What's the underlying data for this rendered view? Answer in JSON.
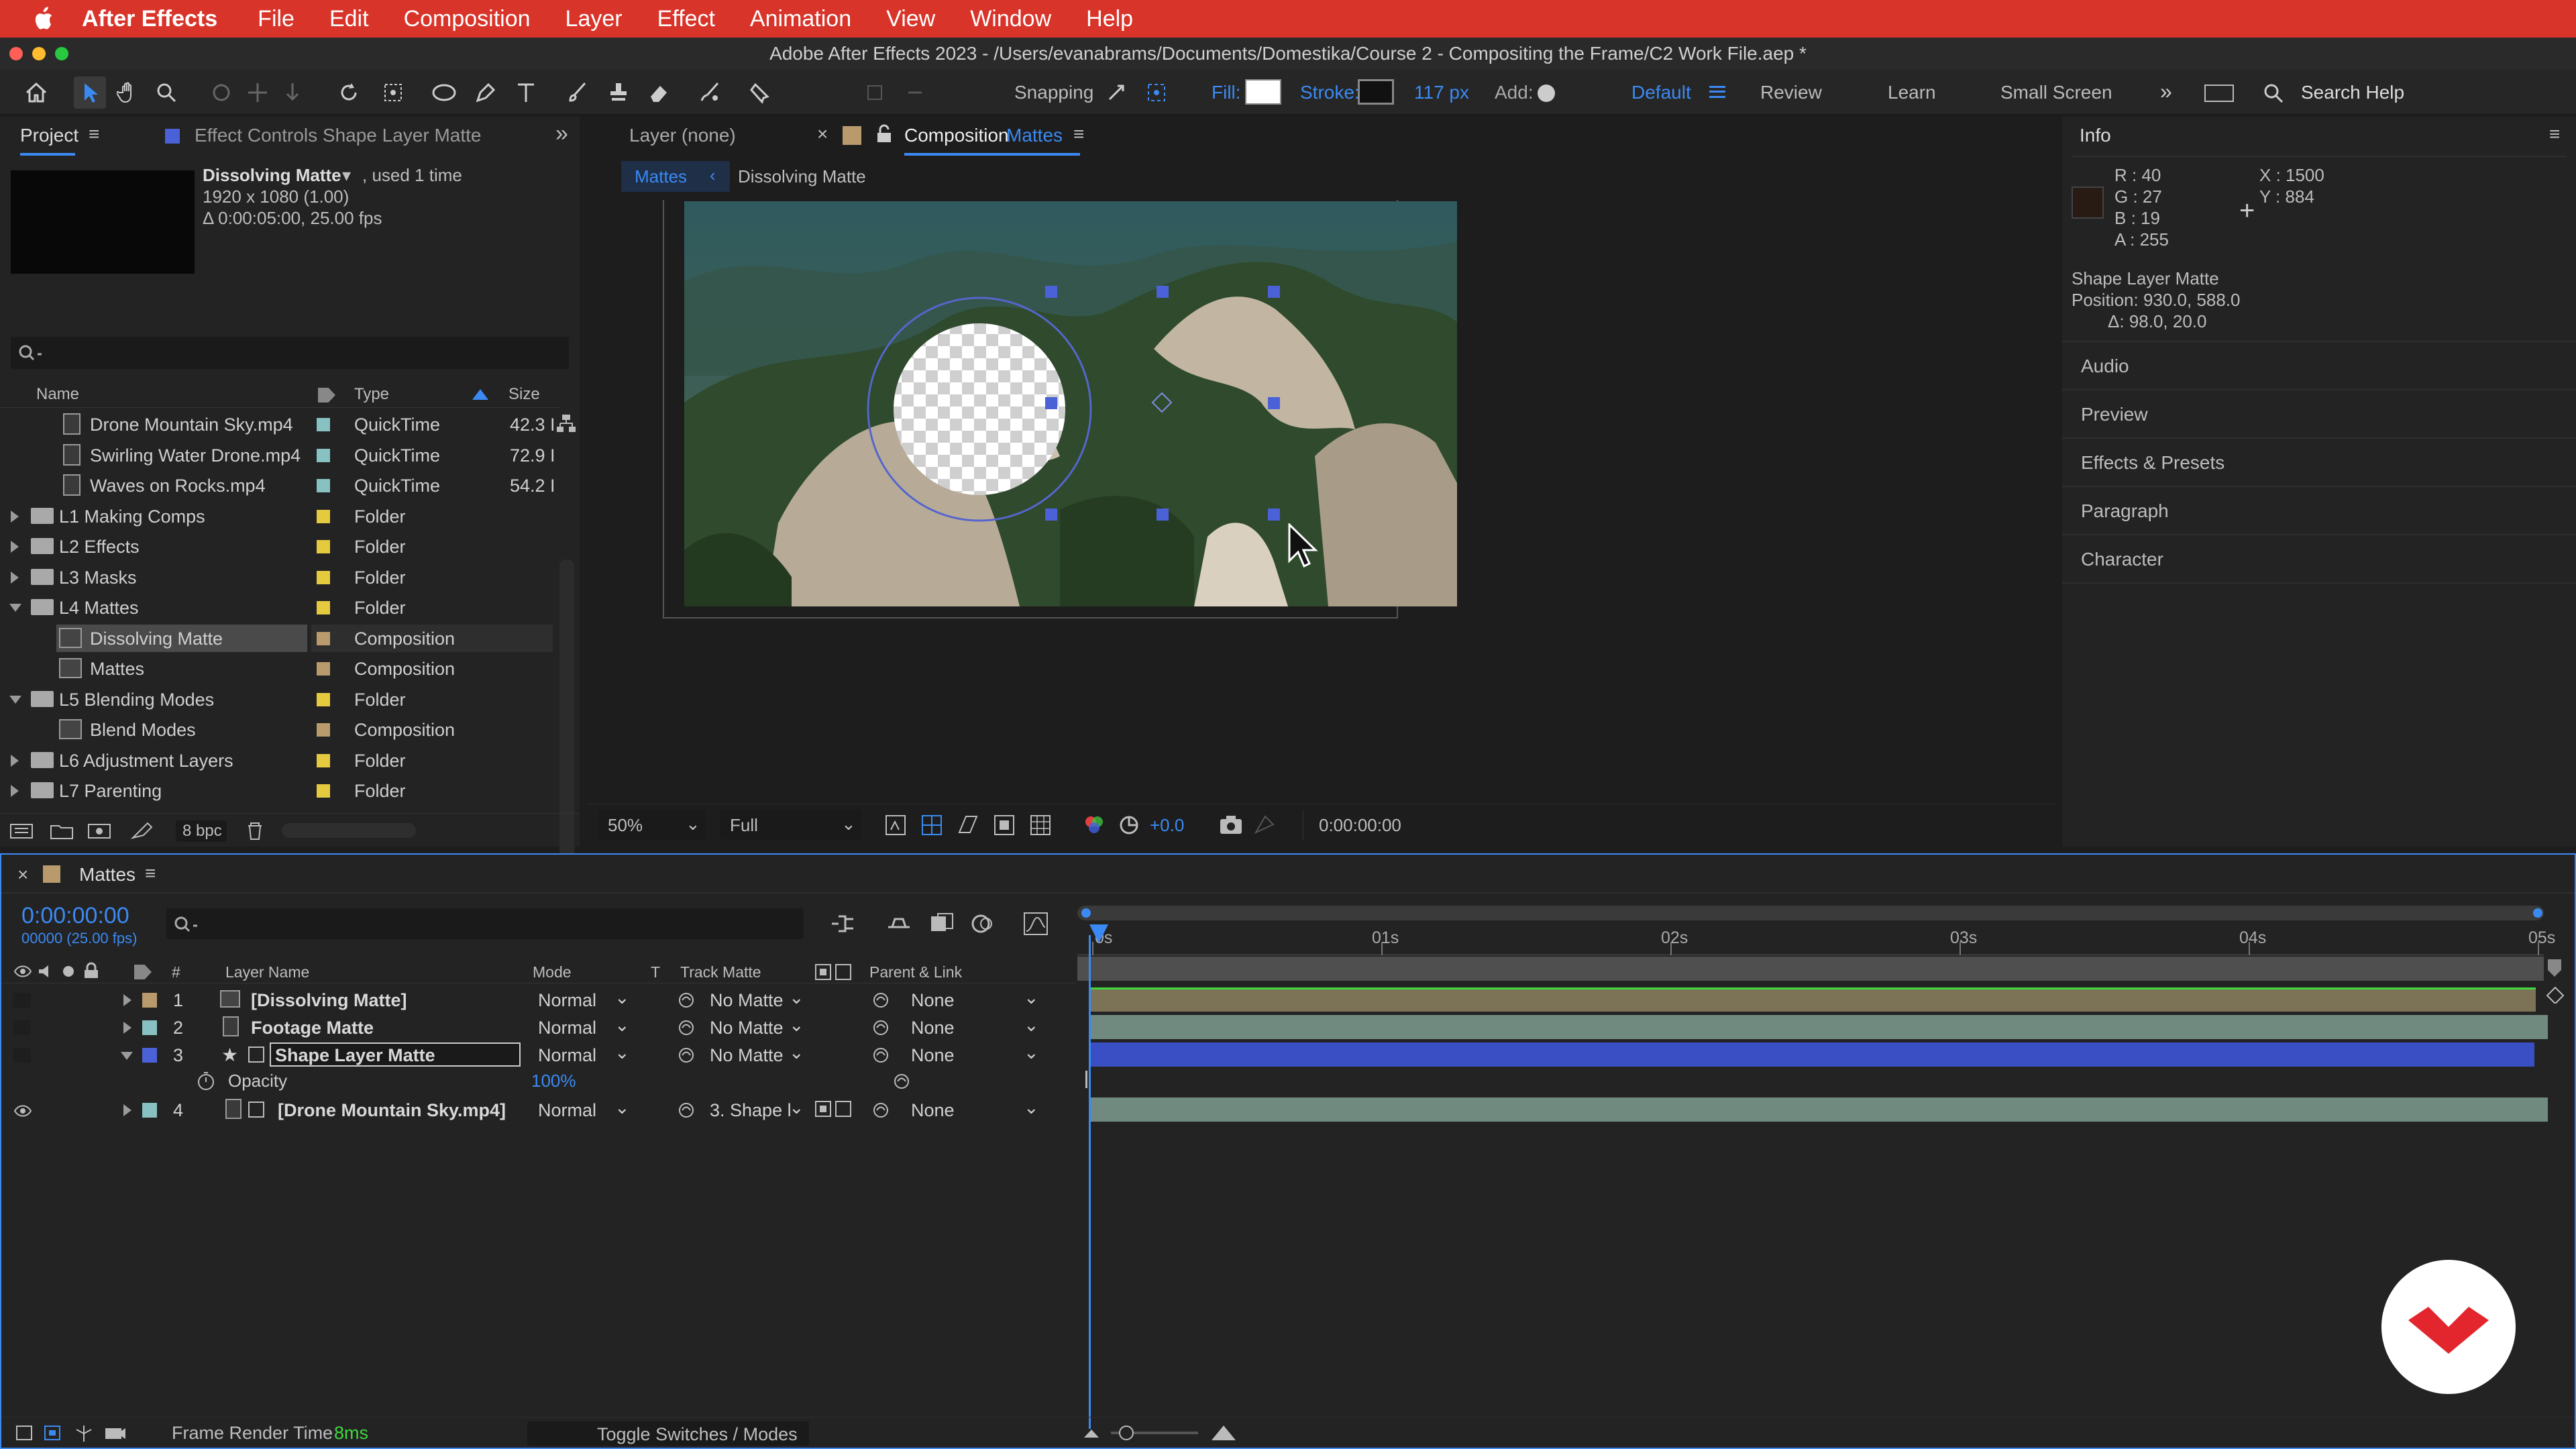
{
  "menubar": {
    "app": "After Effects",
    "items": [
      "File",
      "Edit",
      "Composition",
      "Layer",
      "Effect",
      "Animation",
      "View",
      "Window",
      "Help"
    ]
  },
  "window": {
    "title": "Adobe After Effects 2023 - /Users/evanabrams/Documents/Domestika/Course 2 - Compositing the Frame/C2 Work File.aep *"
  },
  "toolbar": {
    "snapping": "Snapping",
    "fill": "Fill:",
    "stroke": "Stroke:",
    "stroke_px": "117 px",
    "add": "Add:",
    "workspaces": [
      "Default",
      "Review",
      "Learn",
      "Small Screen"
    ],
    "search": "Search Help"
  },
  "project": {
    "tab": "Project",
    "effect_tab": "Effect Controls Shape Layer Matte",
    "selected_name": "Dissolving Matte",
    "used": ", used 1 time",
    "dims": "1920 x 1080 (1.00)",
    "duration": "Δ 0:00:05:00, 25.00 fps",
    "columns": {
      "name": "Name",
      "type": "Type",
      "size": "Size"
    },
    "items": [
      {
        "name": "Drone Mountain Sky.mp4",
        "type": "QuickTime",
        "size": "42.3 I",
        "kind": "file",
        "color": "#87c1c1"
      },
      {
        "name": "Swirling Water Drone.mp4",
        "type": "QuickTime",
        "size": "72.9 I",
        "kind": "file",
        "color": "#87c1c1"
      },
      {
        "name": "Waves on Rocks.mp4",
        "type": "QuickTime",
        "size": "54.2 I",
        "kind": "file",
        "color": "#87c1c1"
      },
      {
        "name": "L1 Making Comps",
        "type": "Folder",
        "size": "",
        "kind": "folder",
        "color": "#e5c93e"
      },
      {
        "name": "L2 Effects",
        "type": "Folder",
        "size": "",
        "kind": "folder",
        "color": "#e5c93e"
      },
      {
        "name": "L3 Masks",
        "type": "Folder",
        "size": "",
        "kind": "folder",
        "color": "#e5c93e"
      },
      {
        "name": "L4 Mattes",
        "type": "Folder",
        "size": "",
        "kind": "folder-open",
        "color": "#e5c93e"
      },
      {
        "name": "Dissolving Matte",
        "type": "Composition",
        "size": "",
        "kind": "comp",
        "color": "#b89a6c"
      },
      {
        "name": "Mattes",
        "type": "Composition",
        "size": "",
        "kind": "comp",
        "color": "#b89a6c"
      },
      {
        "name": "L5 Blending Modes",
        "type": "Folder",
        "size": "",
        "kind": "folder-open",
        "color": "#e5c93e"
      },
      {
        "name": "Blend Modes",
        "type": "Composition",
        "size": "",
        "kind": "comp",
        "color": "#b89a6c"
      },
      {
        "name": "L6 Adjustment Layers",
        "type": "Folder",
        "size": "",
        "kind": "folder",
        "color": "#e5c93e"
      },
      {
        "name": "L7 Parenting",
        "type": "Folder",
        "size": "",
        "kind": "folder",
        "color": "#e5c93e"
      }
    ],
    "bpc": "8 bpc"
  },
  "viewer": {
    "layer_tab": "Layer (none)",
    "comp_tab_prefix": "Composition",
    "comp_tab_name": "Mattes",
    "crumb1": "Mattes",
    "crumb2": "Dissolving Matte",
    "zoom": "50%",
    "quality": "Full",
    "exposure": "+0.0",
    "timecode": "0:00:00:00"
  },
  "info": {
    "title": "Info",
    "r": "R : 40",
    "g": "G : 27",
    "b": "B : 19",
    "a": "A : 255",
    "x": "X : 1500",
    "y": "Y : 884",
    "layer": "Shape Layer Matte",
    "position": "Position: 930.0, 588.0",
    "delta": "Δ: 98.0, 20.0",
    "swatch": "#281b13",
    "sections": [
      "Audio",
      "Preview",
      "Effects & Presets",
      "Paragraph",
      "Character"
    ]
  },
  "timeline": {
    "tab": "Mattes",
    "timecode": "0:00:00:00",
    "frames": "00000 (25.00 fps)",
    "headers": {
      "num": "#",
      "layer_name": "Layer Name",
      "mode": "Mode",
      "t": "T",
      "track_matte": "Track Matte",
      "parent": "Parent & Link"
    },
    "ticks": [
      "0s",
      "01s",
      "02s",
      "03s",
      "04s",
      "05s"
    ],
    "layers": [
      {
        "num": "1",
        "name": "[Dissolving Matte]",
        "mode": "Normal",
        "matte": "No Matte",
        "parent": "None",
        "color": "#b89a6c",
        "bar": "#7c7256"
      },
      {
        "num": "2",
        "name": "Footage Matte",
        "mode": "Normal",
        "matte": "No Matte",
        "parent": "None",
        "color": "#87c1c1",
        "bar": "#708a80"
      },
      {
        "num": "3",
        "name": "Shape Layer Matte",
        "mode": "Normal",
        "matte": "No Matte",
        "parent": "None",
        "color": "#4b61d8",
        "bar": "#3b4fc4"
      },
      {
        "num": "4",
        "name": "[Drone Mountain Sky.mp4]",
        "mode": "Normal",
        "matte": "3. Shape l",
        "parent": "None",
        "color": "#87c1c1",
        "bar": "#708a80"
      }
    ],
    "opacity_label": "Opacity",
    "opacity_value": "100%",
    "render_label": "Frame Render Time",
    "render_value": "8ms",
    "toggle": "Toggle Switches / Modes"
  }
}
